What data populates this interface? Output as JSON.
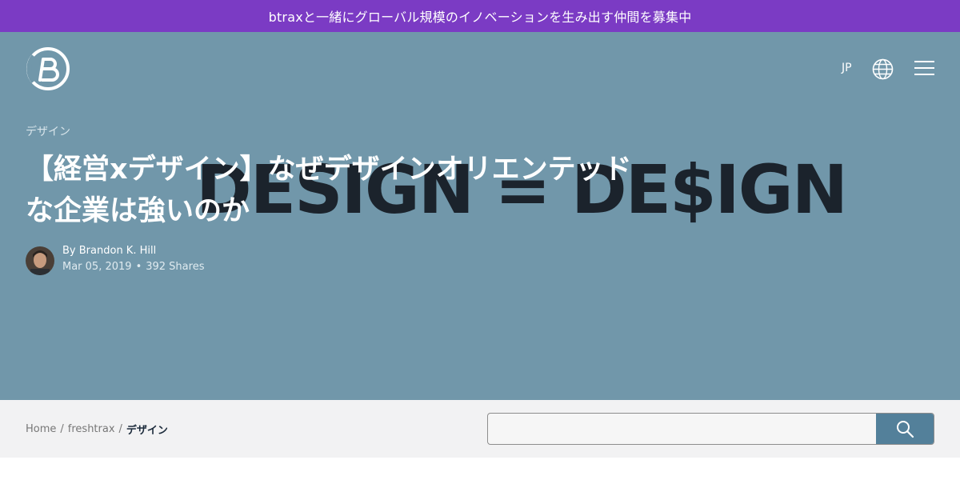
{
  "topbar": {
    "text": "btraxと一緒にグローバル規模のイノベーションを生み出す仲間を募集中"
  },
  "header": {
    "logo_icon": "btrax-b-logo-icon",
    "language": "JP",
    "globe_icon": "globe-icon",
    "menu_icon": "hamburger-menu-icon"
  },
  "hero": {
    "background_text": "DESIGN = DE$IGN",
    "category": "デザイン",
    "title_line1": "【経営xデザイン】なぜデザインオリエンテッド",
    "title_line2": "な企業は強いのか",
    "author_prefix": "By",
    "author_name": "Brandon K. Hill",
    "date": "Mar 05, 2019",
    "shares": "392 Shares"
  },
  "breadcrumb": {
    "items": [
      "Home",
      "freshtrax",
      "デザイン"
    ],
    "separator": "/"
  },
  "search": {
    "placeholder": "",
    "value": "",
    "button_icon": "search-icon"
  },
  "colors": {
    "topbar": "#7b3bc4",
    "hero_bg": "#7197aa",
    "hero_text": "#1b232c",
    "strip_bg": "#f2f2f3",
    "search_button": "#53809a"
  }
}
